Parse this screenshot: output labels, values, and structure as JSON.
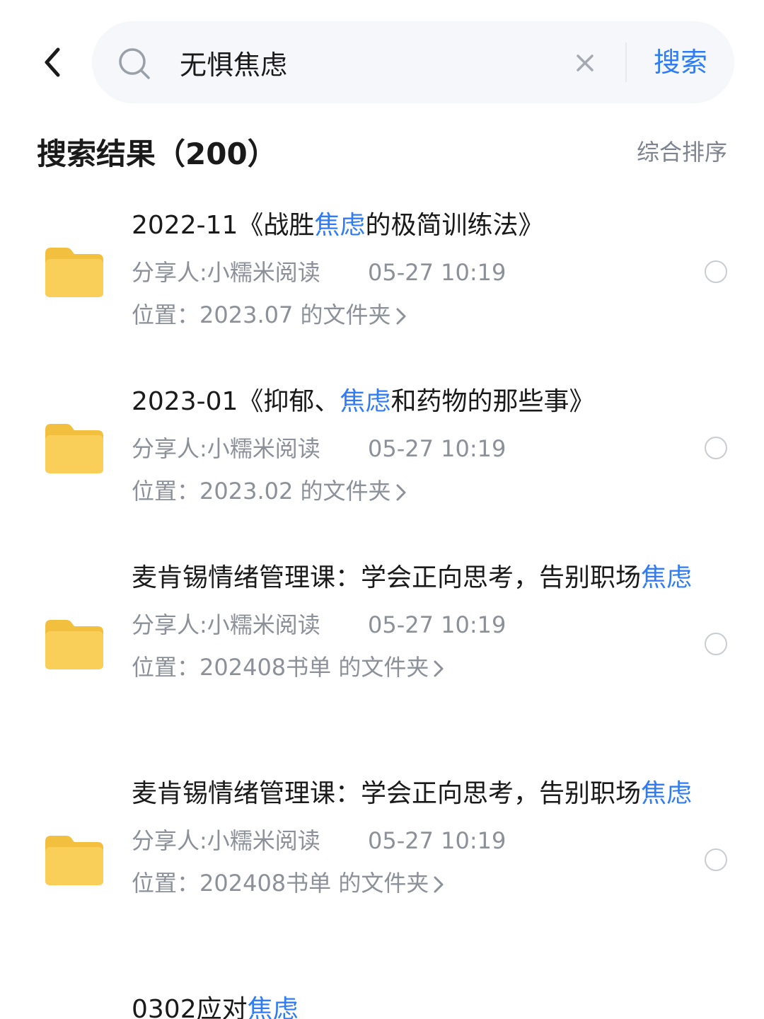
{
  "search": {
    "query": "无惧焦虑",
    "submit_label": "搜索"
  },
  "results_header": {
    "title": "搜索结果（200）",
    "sort_label": "综合排序"
  },
  "colors": {
    "accent": "#2f7cf6",
    "folder": "#f9cf5a",
    "secondary_text": "#8b9099"
  },
  "results": [
    {
      "title_parts": [
        "2022-11《战胜",
        "焦虑",
        "的极简训练法》"
      ],
      "sharer": "分享人:小糯米阅读",
      "time": "05-27 10:19",
      "location": "位置：2023.07 的文件夹"
    },
    {
      "title_parts": [
        "2023-01《抑郁、",
        "焦虑",
        "和药物的那些事》"
      ],
      "sharer": "分享人:小糯米阅读",
      "time": "05-27 10:19",
      "location": "位置：2023.02 的文件夹"
    },
    {
      "title_parts": [
        "麦肯锡情绪管理课：学会正向思考，告别职场",
        "焦虑",
        ""
      ],
      "sharer": "分享人:小糯米阅读",
      "time": "05-27 10:19",
      "location": "位置：202408书单 的文件夹"
    },
    {
      "title_parts": [
        "麦肯锡情绪管理课：学会正向思考，告别职场",
        "焦虑",
        ""
      ],
      "sharer": "分享人:小糯米阅读",
      "time": "05-27 10:19",
      "location": "位置：202408书单 的文件夹"
    },
    {
      "title_parts": [
        "0302应对",
        "焦虑",
        ""
      ]
    }
  ]
}
